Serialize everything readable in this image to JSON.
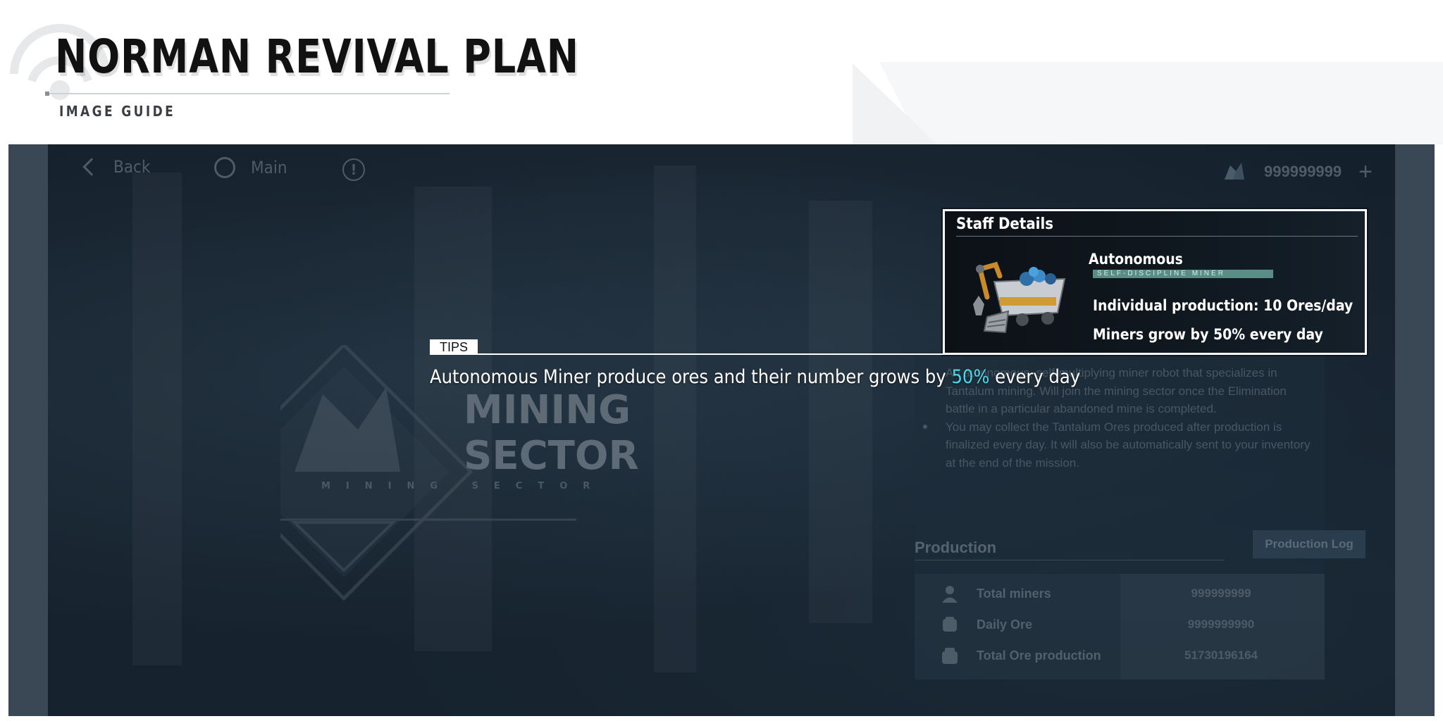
{
  "header": {
    "title": "NORMAN REVIVAL PLAN",
    "subtitle": "IMAGE GUIDE"
  },
  "topbar": {
    "back_label": "Back",
    "main_label": "Main",
    "currency_value": "999999999",
    "plus_label": "+"
  },
  "emblem": {
    "line1": "MINING",
    "line2": "SECTOR",
    "small": "MINING SECTOR"
  },
  "staff_details": {
    "title": "Staff Details",
    "unit_name": "Autonomous",
    "unit_tag": "SELF-DISCIPLINE MINER",
    "stat_production": "Individual production: 10 Ores/day",
    "stat_growth": "Miners grow by 50% every day"
  },
  "description": {
    "paragraph1": "An autonomous, self-multiplying miner robot that specializes in Tantalum mining. Will join the mining sector once the Elimination battle in a particular abandoned mine is completed.",
    "paragraph2": "You may collect the Tantalum Ores produced after production is finalized every day. It will also be automatically sent to your inventory at the end of the mission."
  },
  "production": {
    "title": "Production",
    "log_button": "Production Log",
    "rows": [
      {
        "label": "Total miners",
        "value": "999999999",
        "icon": "person-icon"
      },
      {
        "label": "Daily Ore",
        "value": "9999999990",
        "icon": "ore-icon"
      },
      {
        "label": "Total Ore production",
        "value": "51730196164",
        "icon": "ore-stack-icon"
      }
    ]
  },
  "tips": {
    "label": "TIPS",
    "text_before": "Autonomous Miner produce ores and their number grows by ",
    "highlight": "50%",
    "text_after": " every day"
  },
  "colors": {
    "accent": "#4fd6e6",
    "tag": "#5a8d86",
    "frame": "#3a4855"
  }
}
